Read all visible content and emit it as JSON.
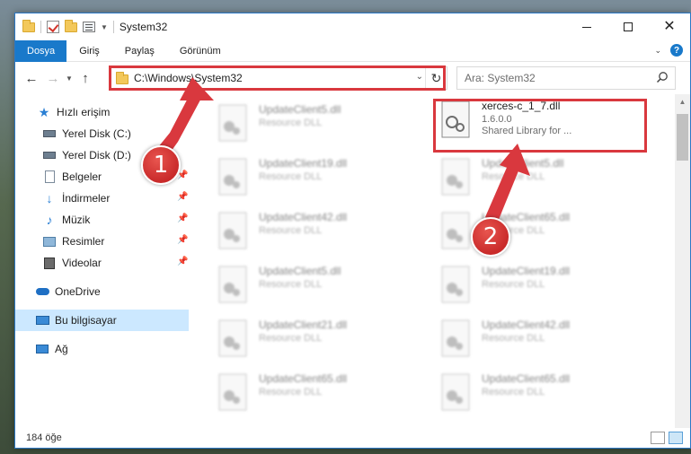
{
  "window": {
    "title": "System32"
  },
  "ribbon": {
    "tabs": [
      "Dosya",
      "Giriş",
      "Paylaş",
      "Görünüm"
    ]
  },
  "navigation": {
    "address": "C:\\Windows\\System32",
    "search_placeholder": "Ara: System32"
  },
  "sidebar": {
    "quick_access": "Hızlı erişim",
    "items": [
      {
        "label": "Yerel Disk (C:)",
        "icon": "drive-icon",
        "pinned": true
      },
      {
        "label": "Yerel Disk (D:)",
        "icon": "drive-icon",
        "pinned": true
      },
      {
        "label": "Belgeler",
        "icon": "documents-icon",
        "pinned": true
      },
      {
        "label": "İndirmeler",
        "icon": "download-icon",
        "pinned": true
      },
      {
        "label": "Müzik",
        "icon": "music-icon",
        "pinned": true
      },
      {
        "label": "Resimler",
        "icon": "pictures-icon",
        "pinned": true
      },
      {
        "label": "Videolar",
        "icon": "videos-icon",
        "pinned": true
      }
    ],
    "onedrive": "OneDrive",
    "this_pc": "Bu bilgisayar",
    "network": "Ağ"
  },
  "files": {
    "highlighted": {
      "name": "xerces-c_1_7.dll",
      "version": "1.6.0.0",
      "type": "Shared Library for ..."
    },
    "left_column": [
      {
        "name": "UpdateClient5.dll",
        "type": "Resource DLL"
      },
      {
        "name": "UpdateClient19.dll",
        "type": "Resource DLL"
      },
      {
        "name": "UpdateClient42.dll",
        "type": "Resource DLL"
      },
      {
        "name": "UpdateClient5.dll",
        "type": "Resource DLL"
      },
      {
        "name": "UpdateClient21.dll",
        "type": "Resource DLL"
      },
      {
        "name": "UpdateClient65.dll",
        "type": "Resource DLL"
      }
    ],
    "right_column": [
      {
        "name": "UpdateClient5.dll",
        "type": "Resource DLL"
      },
      {
        "name": "UpdateClient65.dll",
        "type": "Resource DLL"
      },
      {
        "name": "UpdateClient19.dll",
        "type": "Resource DLL"
      },
      {
        "name": "UpdateClient42.dll",
        "type": "Resource DLL"
      },
      {
        "name": "UpdateClient65.dll",
        "type": "Resource DLL"
      }
    ]
  },
  "status": {
    "item_count": "184 öğe"
  },
  "annotations": {
    "badge1": "1",
    "badge2": "2",
    "accent_color": "#d9383e"
  }
}
